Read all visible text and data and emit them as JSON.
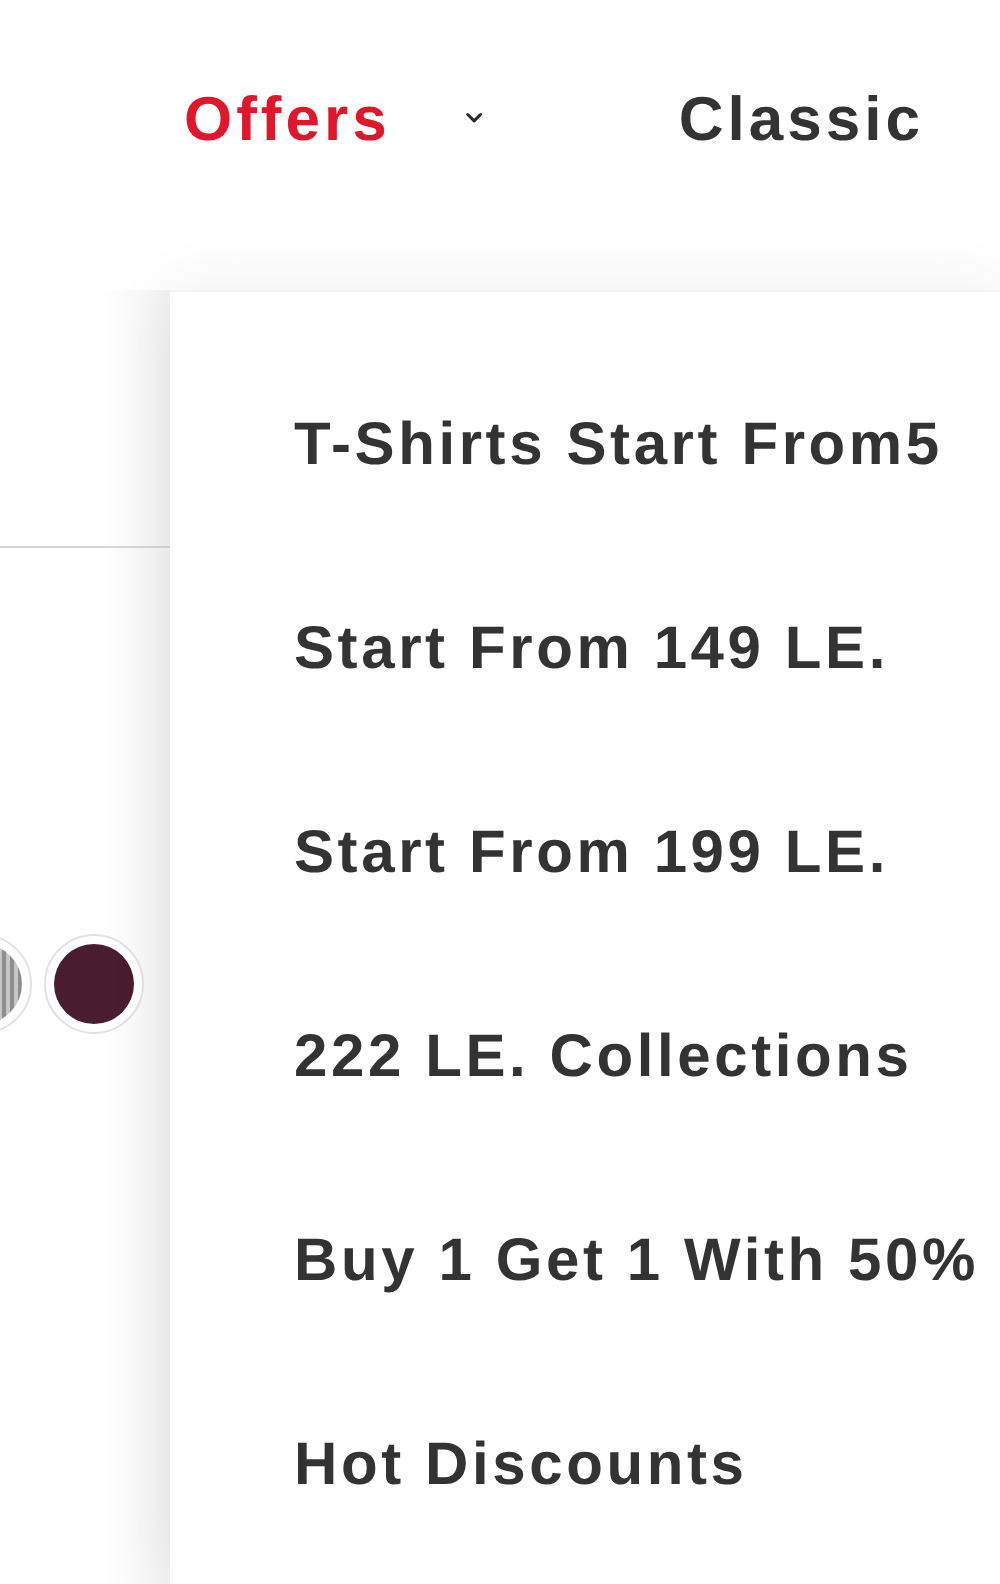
{
  "nav": [
    {
      "label": "Offers",
      "selected": true,
      "has_dropdown": true
    },
    {
      "label": "Classic",
      "selected": false,
      "has_dropdown": false
    }
  ],
  "swatches": [
    {
      "color": "#8e8e8e",
      "kind": "pattern"
    },
    {
      "color": "#4a1d2e",
      "kind": "solid"
    }
  ],
  "dropdown": {
    "items": [
      "T-Shirts Start From5",
      "Start From 149 LE.",
      "Start From 199 LE.",
      "222 LE. Collections",
      "Buy 1 Get 1 With 50%",
      "Hot Discounts"
    ]
  }
}
